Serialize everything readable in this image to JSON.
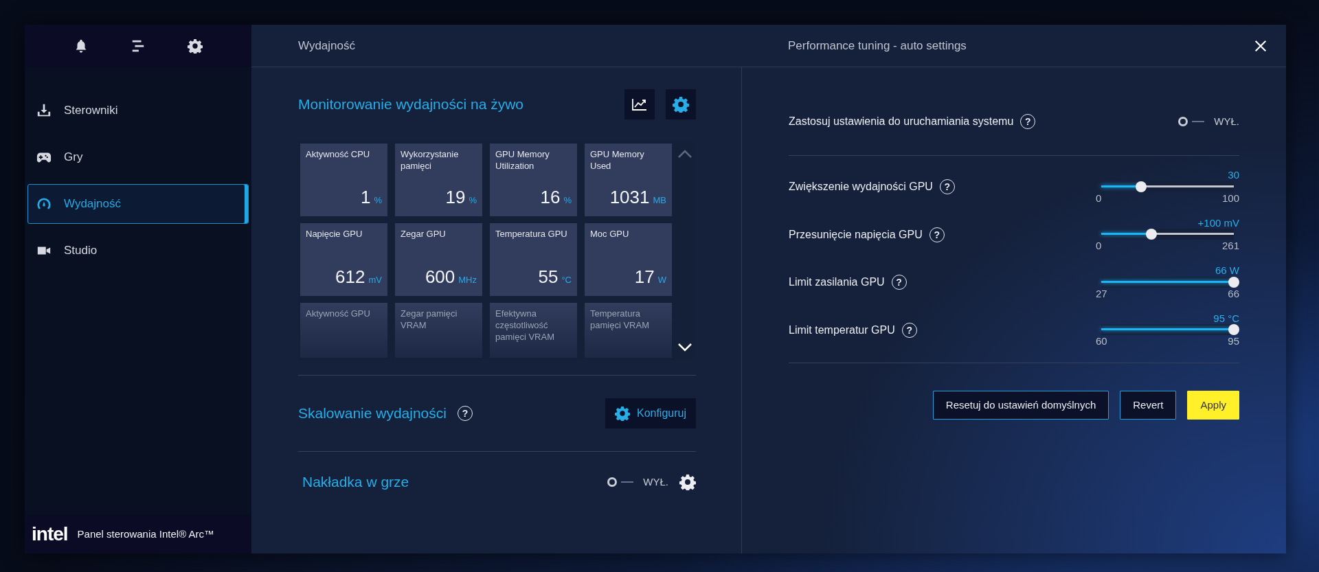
{
  "sidebar": {
    "items": [
      {
        "label": "Sterowniki",
        "selected": false
      },
      {
        "label": "Gry",
        "selected": false
      },
      {
        "label": "Wydajność",
        "selected": true
      },
      {
        "label": "Studio",
        "selected": false
      }
    ],
    "footer": {
      "logo": "intel",
      "title": "Panel sterowania Intel® Arc™"
    }
  },
  "header": {
    "section": "Wydajność",
    "panel_title": "Performance tuning - auto settings"
  },
  "monitoring": {
    "title": "Monitorowanie wydajności na żywo",
    "tiles": [
      {
        "label": "Aktywność CPU",
        "value": "1",
        "unit": "%"
      },
      {
        "label": "Wykorzystanie pamięci",
        "value": "19",
        "unit": "%"
      },
      {
        "label": "GPU Memory Utilization",
        "value": "16",
        "unit": "%"
      },
      {
        "label": "GPU Memory Used",
        "value": "1031",
        "unit": "MB"
      },
      {
        "label": "Napięcie GPU",
        "value": "612",
        "unit": "mV"
      },
      {
        "label": "Zegar GPU",
        "value": "600",
        "unit": "MHz"
      },
      {
        "label": "Temperatura GPU",
        "value": "55",
        "unit": "°C"
      },
      {
        "label": "Moc GPU",
        "value": "17",
        "unit": "W"
      },
      {
        "label": "Aktywność GPU"
      },
      {
        "label": "Zegar pamięci VRAM"
      },
      {
        "label": "Efektywna częstotliwość pamięci VRAM"
      },
      {
        "label": "Temperatura pamięci VRAM"
      }
    ]
  },
  "scaling": {
    "title": "Skalowanie wydajności",
    "help": "?",
    "button": "Konfiguruj"
  },
  "overlay": {
    "title": "Nakładka w grze",
    "on": false,
    "state_label": "WYŁ."
  },
  "tuning": {
    "boot": {
      "label": "Zastosuj ustawienia do uruchamiania systemu",
      "help": "?",
      "on": false,
      "state_label": "WYŁ."
    },
    "sliders": [
      {
        "label": "Zwiększenie wydajności GPU",
        "help": "?",
        "reading": "30",
        "min": "0",
        "max": "100",
        "level": 0.3
      },
      {
        "label": "Przesunięcie napięcia GPU",
        "help": "?",
        "reading": "+100 mV",
        "min": "0",
        "max": "261",
        "level": 0.38
      },
      {
        "label": "Limit zasilania GPU",
        "help": "?",
        "reading": "66 W",
        "min": "27",
        "max": "66",
        "level": 1
      },
      {
        "label": "Limit temperatur GPU",
        "help": "?",
        "reading": "95 °C",
        "min": "60",
        "max": "95",
        "level": 1
      }
    ],
    "buttons": [
      {
        "label": "Resetuj do ustawień domyślnych",
        "kind": "outline"
      },
      {
        "label": "Revert",
        "kind": "outline"
      },
      {
        "label": "Apply",
        "kind": "primary"
      }
    ]
  }
}
